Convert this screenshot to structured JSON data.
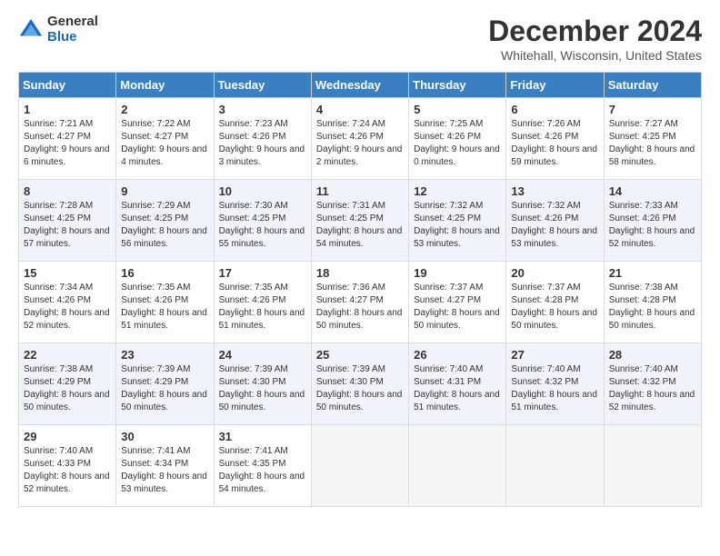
{
  "logo": {
    "general": "General",
    "blue": "Blue"
  },
  "title": "December 2024",
  "location": "Whitehall, Wisconsin, United States",
  "headers": [
    "Sunday",
    "Monday",
    "Tuesday",
    "Wednesday",
    "Thursday",
    "Friday",
    "Saturday"
  ],
  "weeks": [
    [
      {
        "day": "1",
        "sunrise": "Sunrise: 7:21 AM",
        "sunset": "Sunset: 4:27 PM",
        "daylight": "Daylight: 9 hours and 6 minutes."
      },
      {
        "day": "2",
        "sunrise": "Sunrise: 7:22 AM",
        "sunset": "Sunset: 4:27 PM",
        "daylight": "Daylight: 9 hours and 4 minutes."
      },
      {
        "day": "3",
        "sunrise": "Sunrise: 7:23 AM",
        "sunset": "Sunset: 4:26 PM",
        "daylight": "Daylight: 9 hours and 3 minutes."
      },
      {
        "day": "4",
        "sunrise": "Sunrise: 7:24 AM",
        "sunset": "Sunset: 4:26 PM",
        "daylight": "Daylight: 9 hours and 2 minutes."
      },
      {
        "day": "5",
        "sunrise": "Sunrise: 7:25 AM",
        "sunset": "Sunset: 4:26 PM",
        "daylight": "Daylight: 9 hours and 0 minutes."
      },
      {
        "day": "6",
        "sunrise": "Sunrise: 7:26 AM",
        "sunset": "Sunset: 4:26 PM",
        "daylight": "Daylight: 8 hours and 59 minutes."
      },
      {
        "day": "7",
        "sunrise": "Sunrise: 7:27 AM",
        "sunset": "Sunset: 4:25 PM",
        "daylight": "Daylight: 8 hours and 58 minutes."
      }
    ],
    [
      {
        "day": "8",
        "sunrise": "Sunrise: 7:28 AM",
        "sunset": "Sunset: 4:25 PM",
        "daylight": "Daylight: 8 hours and 57 minutes."
      },
      {
        "day": "9",
        "sunrise": "Sunrise: 7:29 AM",
        "sunset": "Sunset: 4:25 PM",
        "daylight": "Daylight: 8 hours and 56 minutes."
      },
      {
        "day": "10",
        "sunrise": "Sunrise: 7:30 AM",
        "sunset": "Sunset: 4:25 PM",
        "daylight": "Daylight: 8 hours and 55 minutes."
      },
      {
        "day": "11",
        "sunrise": "Sunrise: 7:31 AM",
        "sunset": "Sunset: 4:25 PM",
        "daylight": "Daylight: 8 hours and 54 minutes."
      },
      {
        "day": "12",
        "sunrise": "Sunrise: 7:32 AM",
        "sunset": "Sunset: 4:25 PM",
        "daylight": "Daylight: 8 hours and 53 minutes."
      },
      {
        "day": "13",
        "sunrise": "Sunrise: 7:32 AM",
        "sunset": "Sunset: 4:26 PM",
        "daylight": "Daylight: 8 hours and 53 minutes."
      },
      {
        "day": "14",
        "sunrise": "Sunrise: 7:33 AM",
        "sunset": "Sunset: 4:26 PM",
        "daylight": "Daylight: 8 hours and 52 minutes."
      }
    ],
    [
      {
        "day": "15",
        "sunrise": "Sunrise: 7:34 AM",
        "sunset": "Sunset: 4:26 PM",
        "daylight": "Daylight: 8 hours and 52 minutes."
      },
      {
        "day": "16",
        "sunrise": "Sunrise: 7:35 AM",
        "sunset": "Sunset: 4:26 PM",
        "daylight": "Daylight: 8 hours and 51 minutes."
      },
      {
        "day": "17",
        "sunrise": "Sunrise: 7:35 AM",
        "sunset": "Sunset: 4:26 PM",
        "daylight": "Daylight: 8 hours and 51 minutes."
      },
      {
        "day": "18",
        "sunrise": "Sunrise: 7:36 AM",
        "sunset": "Sunset: 4:27 PM",
        "daylight": "Daylight: 8 hours and 50 minutes."
      },
      {
        "day": "19",
        "sunrise": "Sunrise: 7:37 AM",
        "sunset": "Sunset: 4:27 PM",
        "daylight": "Daylight: 8 hours and 50 minutes."
      },
      {
        "day": "20",
        "sunrise": "Sunrise: 7:37 AM",
        "sunset": "Sunset: 4:28 PM",
        "daylight": "Daylight: 8 hours and 50 minutes."
      },
      {
        "day": "21",
        "sunrise": "Sunrise: 7:38 AM",
        "sunset": "Sunset: 4:28 PM",
        "daylight": "Daylight: 8 hours and 50 minutes."
      }
    ],
    [
      {
        "day": "22",
        "sunrise": "Sunrise: 7:38 AM",
        "sunset": "Sunset: 4:29 PM",
        "daylight": "Daylight: 8 hours and 50 minutes."
      },
      {
        "day": "23",
        "sunrise": "Sunrise: 7:39 AM",
        "sunset": "Sunset: 4:29 PM",
        "daylight": "Daylight: 8 hours and 50 minutes."
      },
      {
        "day": "24",
        "sunrise": "Sunrise: 7:39 AM",
        "sunset": "Sunset: 4:30 PM",
        "daylight": "Daylight: 8 hours and 50 minutes."
      },
      {
        "day": "25",
        "sunrise": "Sunrise: 7:39 AM",
        "sunset": "Sunset: 4:30 PM",
        "daylight": "Daylight: 8 hours and 50 minutes."
      },
      {
        "day": "26",
        "sunrise": "Sunrise: 7:40 AM",
        "sunset": "Sunset: 4:31 PM",
        "daylight": "Daylight: 8 hours and 51 minutes."
      },
      {
        "day": "27",
        "sunrise": "Sunrise: 7:40 AM",
        "sunset": "Sunset: 4:32 PM",
        "daylight": "Daylight: 8 hours and 51 minutes."
      },
      {
        "day": "28",
        "sunrise": "Sunrise: 7:40 AM",
        "sunset": "Sunset: 4:32 PM",
        "daylight": "Daylight: 8 hours and 52 minutes."
      }
    ],
    [
      {
        "day": "29",
        "sunrise": "Sunrise: 7:40 AM",
        "sunset": "Sunset: 4:33 PM",
        "daylight": "Daylight: 8 hours and 52 minutes."
      },
      {
        "day": "30",
        "sunrise": "Sunrise: 7:41 AM",
        "sunset": "Sunset: 4:34 PM",
        "daylight": "Daylight: 8 hours and 53 minutes."
      },
      {
        "day": "31",
        "sunrise": "Sunrise: 7:41 AM",
        "sunset": "Sunset: 4:35 PM",
        "daylight": "Daylight: 8 hours and 54 minutes."
      },
      null,
      null,
      null,
      null
    ]
  ]
}
